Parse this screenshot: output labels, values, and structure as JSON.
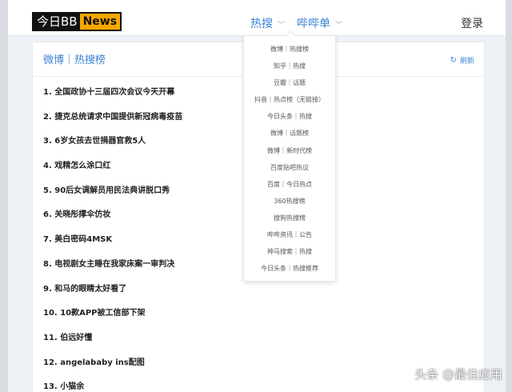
{
  "header": {
    "logo_text": "今日BB",
    "logo_badge": "News",
    "nav": [
      {
        "label": "热搜"
      },
      {
        "label": "哔哔单"
      }
    ],
    "login": "登录"
  },
  "card": {
    "title": "微博｜热搜榜",
    "refresh": "刷新",
    "items": [
      "1. 全国政协十三届四次会议今天开幕",
      "2. 捷克总统请求中国提供新冠病毒疫苗",
      "3. 6岁女孩去世捐器官救5人",
      "4. 戏精怎么涂口红",
      "5. 90后女调解员用民法典讲脱口秀",
      "6. 关晓彤撑伞仿妆",
      "7. 美白密码4MSK",
      "8. 电视剧女主睡在我家床案一审判决",
      "9. 和马的眼睛太好看了",
      "10. 10款APP被工信部下架",
      "11. 伯远好懂",
      "12. angelababy ins配图",
      "13. 小猫余"
    ]
  },
  "dropdown": {
    "items": [
      "微博｜热搜榜",
      "知乎｜热搜",
      "豆瓣｜话题",
      "抖音｜热点榜（无链接）",
      "今日头条｜热搜",
      "微博｜话题榜",
      "微博｜新时代榜",
      "百度贴吧热议",
      "百度｜今日热点",
      "360热搜榜",
      "搜狗热搜榜",
      "哔哔资讯｜公告",
      "神马搜索｜热搜",
      "今日头条｜热搜推荐"
    ]
  },
  "watermark": "头条 @最佳应用",
  "colors": {
    "accent": "#3b83d6",
    "logo_badge": "#f7a700"
  }
}
